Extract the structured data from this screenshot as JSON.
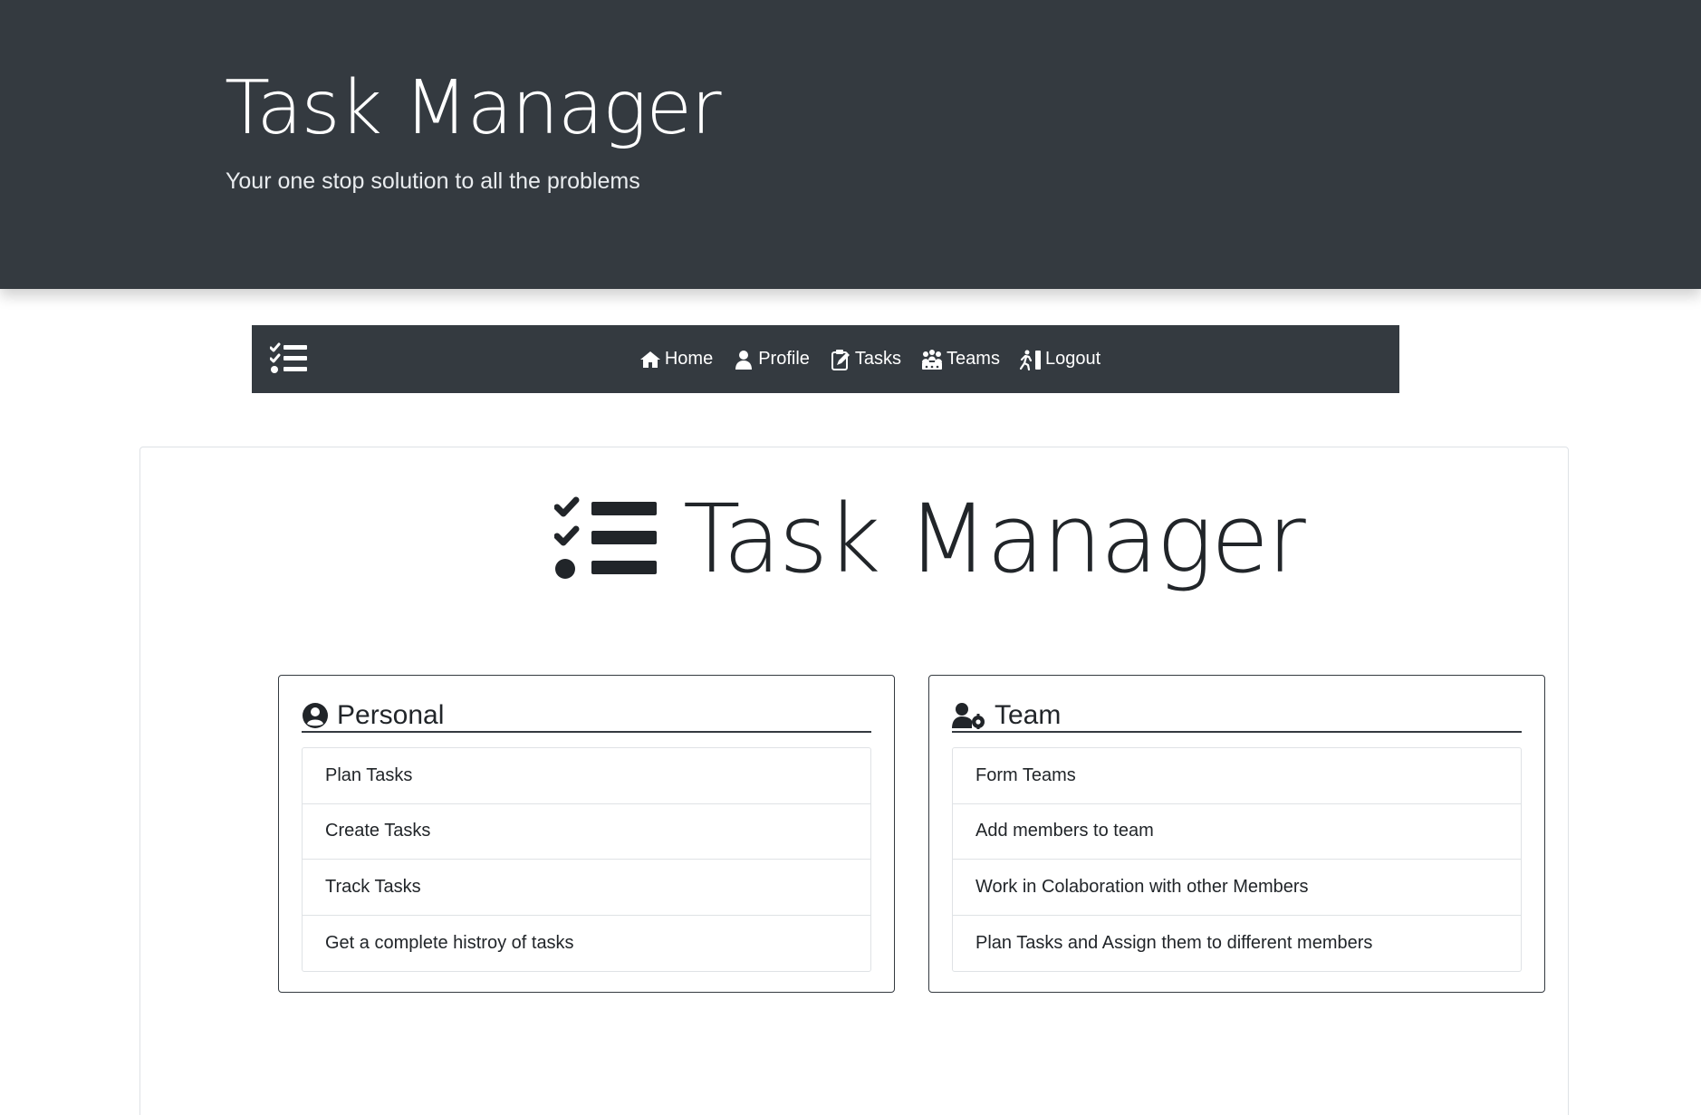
{
  "header": {
    "title": "Task Manager",
    "subtitle": "Your one stop solution to all the problems"
  },
  "navbar": {
    "brand_icon": "tasks-list-icon",
    "links": [
      {
        "label": "Home",
        "icon": "home-icon"
      },
      {
        "label": "Profile",
        "icon": "user-icon"
      },
      {
        "label": "Tasks",
        "icon": "clipboard-edit-icon"
      },
      {
        "label": "Teams",
        "icon": "people-group-icon"
      },
      {
        "label": "Logout",
        "icon": "door-exit-icon"
      }
    ]
  },
  "hero": {
    "title": "Task Manager",
    "icon": "tasks-list-icon"
  },
  "personal": {
    "title": "Personal",
    "icon": "user-circle-icon",
    "items": [
      "Plan Tasks",
      "Create Tasks",
      "Track Tasks",
      "Get a complete histroy of tasks"
    ]
  },
  "team": {
    "title": "Team",
    "icon": "user-cog-icon",
    "items": [
      "Form Teams",
      "Add members to team",
      "Work in Colaboration with other Members",
      "Plan Tasks and Assign them to different members"
    ]
  },
  "colors": {
    "dark": "#343a40",
    "text": "#212529",
    "white": "#ffffff"
  }
}
